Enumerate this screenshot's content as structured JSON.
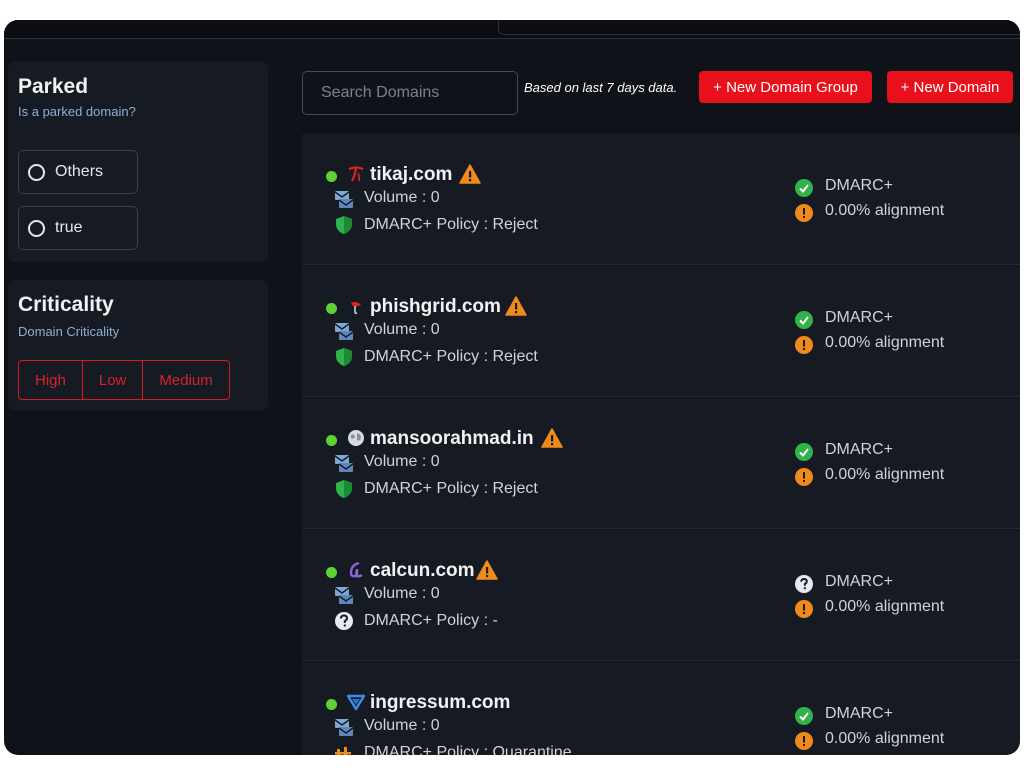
{
  "filters": {
    "parked": {
      "title": "Parked",
      "subtitle": "Is a parked domain?",
      "options": [
        "Others",
        "true"
      ]
    },
    "criticality": {
      "title": "Criticality",
      "subtitle": "Domain Criticality",
      "options": [
        "High",
        "Low",
        "Medium"
      ]
    }
  },
  "toolbar": {
    "search_placeholder": "Search Domains",
    "note": "Based on last 7 days data.",
    "new_group_label": "+ New Domain Group",
    "new_domain_label": "+ New Domain"
  },
  "colors": {
    "accent_red": "#e8111b",
    "status_green": "#5fd233",
    "check_green": "#2fb34a",
    "warning_orange": "#f08a1c"
  },
  "domains": [
    {
      "name": "tikaj.com",
      "brand_icon": "tikaj-logo-icon",
      "volume": "Volume : 0",
      "policy": "DMARC+ Policy : Reject",
      "policy_icon": "shield-icon",
      "dmarc_label": "DMARC+",
      "dmarc_icon": "check-circle-icon",
      "alignment": "0.00% alignment"
    },
    {
      "name": "phishgrid.com",
      "brand_icon": "phishgrid-logo-icon",
      "volume": "Volume : 0",
      "policy": "DMARC+ Policy : Reject",
      "policy_icon": "shield-icon",
      "dmarc_label": "DMARC+",
      "dmarc_icon": "check-circle-icon",
      "alignment": "0.00% alignment"
    },
    {
      "name": "mansoorahmad.in",
      "brand_icon": "globe-icon",
      "volume": "Volume : 0",
      "policy": "DMARC+ Policy : Reject",
      "policy_icon": "shield-icon",
      "dmarc_label": "DMARC+",
      "dmarc_icon": "check-circle-icon",
      "alignment": "0.00% alignment"
    },
    {
      "name": "calcun.com",
      "brand_icon": "calcun-logo-icon",
      "volume": "Volume : 0",
      "policy": "DMARC+ Policy : -",
      "policy_icon": "question-circle-icon",
      "dmarc_label": "DMARC+",
      "dmarc_icon": "question-circle-icon",
      "alignment": "0.00% alignment"
    },
    {
      "name": "ingressum.com",
      "brand_icon": "ingressum-logo-icon",
      "volume": "Volume : 0",
      "policy": "DMARC+ Policy : Quarantine",
      "policy_icon": "quarantine-icon",
      "dmarc_label": "DMARC+",
      "dmarc_icon": "check-circle-icon",
      "alignment": "0.00% alignment"
    }
  ]
}
